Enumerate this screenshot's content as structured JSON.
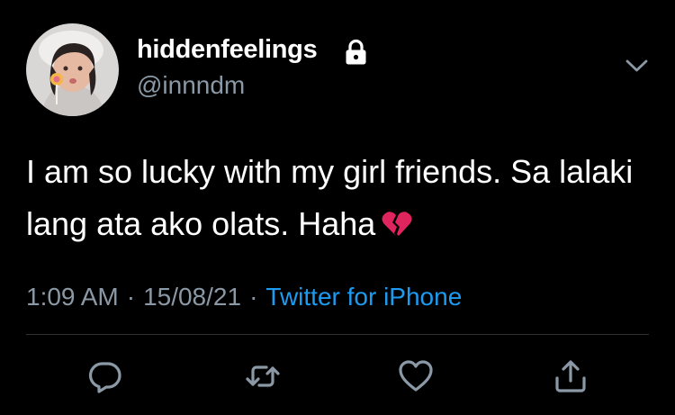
{
  "user": {
    "display_name": "hiddenfeelings",
    "handle": "@innndm",
    "avatar_icon": "avatar-photo",
    "protected_icon": "lock-icon"
  },
  "tweet": {
    "text": "I am so lucky with my girl friends. Sa lalaki lang ata ako olats. Haha",
    "emoji": "broken-heart-icon"
  },
  "meta": {
    "time": "1:09 AM",
    "separator": "·",
    "date": "15/08/21",
    "source": "Twitter for iPhone"
  },
  "actions": [
    "reply-icon",
    "retweet-icon",
    "like-icon",
    "share-icon"
  ],
  "colors": {
    "background": "#000000",
    "text": "#ffffff",
    "secondary": "#8b98a5",
    "link": "#1d9bf0",
    "broken_heart": "#e0245e"
  }
}
